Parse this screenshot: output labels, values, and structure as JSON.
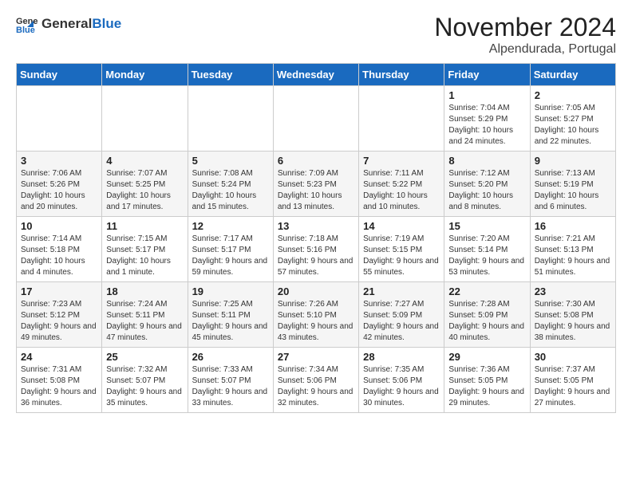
{
  "header": {
    "logo": {
      "general": "General",
      "blue": "Blue"
    },
    "title": "November 2024",
    "location": "Alpendurada, Portugal"
  },
  "calendar": {
    "days_of_week": [
      "Sunday",
      "Monday",
      "Tuesday",
      "Wednesday",
      "Thursday",
      "Friday",
      "Saturday"
    ],
    "weeks": [
      [
        {
          "day": "",
          "info": ""
        },
        {
          "day": "",
          "info": ""
        },
        {
          "day": "",
          "info": ""
        },
        {
          "day": "",
          "info": ""
        },
        {
          "day": "",
          "info": ""
        },
        {
          "day": "1",
          "info": "Sunrise: 7:04 AM\nSunset: 5:29 PM\nDaylight: 10 hours and 24 minutes."
        },
        {
          "day": "2",
          "info": "Sunrise: 7:05 AM\nSunset: 5:27 PM\nDaylight: 10 hours and 22 minutes."
        }
      ],
      [
        {
          "day": "3",
          "info": "Sunrise: 7:06 AM\nSunset: 5:26 PM\nDaylight: 10 hours and 20 minutes."
        },
        {
          "day": "4",
          "info": "Sunrise: 7:07 AM\nSunset: 5:25 PM\nDaylight: 10 hours and 17 minutes."
        },
        {
          "day": "5",
          "info": "Sunrise: 7:08 AM\nSunset: 5:24 PM\nDaylight: 10 hours and 15 minutes."
        },
        {
          "day": "6",
          "info": "Sunrise: 7:09 AM\nSunset: 5:23 PM\nDaylight: 10 hours and 13 minutes."
        },
        {
          "day": "7",
          "info": "Sunrise: 7:11 AM\nSunset: 5:22 PM\nDaylight: 10 hours and 10 minutes."
        },
        {
          "day": "8",
          "info": "Sunrise: 7:12 AM\nSunset: 5:20 PM\nDaylight: 10 hours and 8 minutes."
        },
        {
          "day": "9",
          "info": "Sunrise: 7:13 AM\nSunset: 5:19 PM\nDaylight: 10 hours and 6 minutes."
        }
      ],
      [
        {
          "day": "10",
          "info": "Sunrise: 7:14 AM\nSunset: 5:18 PM\nDaylight: 10 hours and 4 minutes."
        },
        {
          "day": "11",
          "info": "Sunrise: 7:15 AM\nSunset: 5:17 PM\nDaylight: 10 hours and 1 minute."
        },
        {
          "day": "12",
          "info": "Sunrise: 7:17 AM\nSunset: 5:17 PM\nDaylight: 9 hours and 59 minutes."
        },
        {
          "day": "13",
          "info": "Sunrise: 7:18 AM\nSunset: 5:16 PM\nDaylight: 9 hours and 57 minutes."
        },
        {
          "day": "14",
          "info": "Sunrise: 7:19 AM\nSunset: 5:15 PM\nDaylight: 9 hours and 55 minutes."
        },
        {
          "day": "15",
          "info": "Sunrise: 7:20 AM\nSunset: 5:14 PM\nDaylight: 9 hours and 53 minutes."
        },
        {
          "day": "16",
          "info": "Sunrise: 7:21 AM\nSunset: 5:13 PM\nDaylight: 9 hours and 51 minutes."
        }
      ],
      [
        {
          "day": "17",
          "info": "Sunrise: 7:23 AM\nSunset: 5:12 PM\nDaylight: 9 hours and 49 minutes."
        },
        {
          "day": "18",
          "info": "Sunrise: 7:24 AM\nSunset: 5:11 PM\nDaylight: 9 hours and 47 minutes."
        },
        {
          "day": "19",
          "info": "Sunrise: 7:25 AM\nSunset: 5:11 PM\nDaylight: 9 hours and 45 minutes."
        },
        {
          "day": "20",
          "info": "Sunrise: 7:26 AM\nSunset: 5:10 PM\nDaylight: 9 hours and 43 minutes."
        },
        {
          "day": "21",
          "info": "Sunrise: 7:27 AM\nSunset: 5:09 PM\nDaylight: 9 hours and 42 minutes."
        },
        {
          "day": "22",
          "info": "Sunrise: 7:28 AM\nSunset: 5:09 PM\nDaylight: 9 hours and 40 minutes."
        },
        {
          "day": "23",
          "info": "Sunrise: 7:30 AM\nSunset: 5:08 PM\nDaylight: 9 hours and 38 minutes."
        }
      ],
      [
        {
          "day": "24",
          "info": "Sunrise: 7:31 AM\nSunset: 5:08 PM\nDaylight: 9 hours and 36 minutes."
        },
        {
          "day": "25",
          "info": "Sunrise: 7:32 AM\nSunset: 5:07 PM\nDaylight: 9 hours and 35 minutes."
        },
        {
          "day": "26",
          "info": "Sunrise: 7:33 AM\nSunset: 5:07 PM\nDaylight: 9 hours and 33 minutes."
        },
        {
          "day": "27",
          "info": "Sunrise: 7:34 AM\nSunset: 5:06 PM\nDaylight: 9 hours and 32 minutes."
        },
        {
          "day": "28",
          "info": "Sunrise: 7:35 AM\nSunset: 5:06 PM\nDaylight: 9 hours and 30 minutes."
        },
        {
          "day": "29",
          "info": "Sunrise: 7:36 AM\nSunset: 5:05 PM\nDaylight: 9 hours and 29 minutes."
        },
        {
          "day": "30",
          "info": "Sunrise: 7:37 AM\nSunset: 5:05 PM\nDaylight: 9 hours and 27 minutes."
        }
      ]
    ]
  }
}
